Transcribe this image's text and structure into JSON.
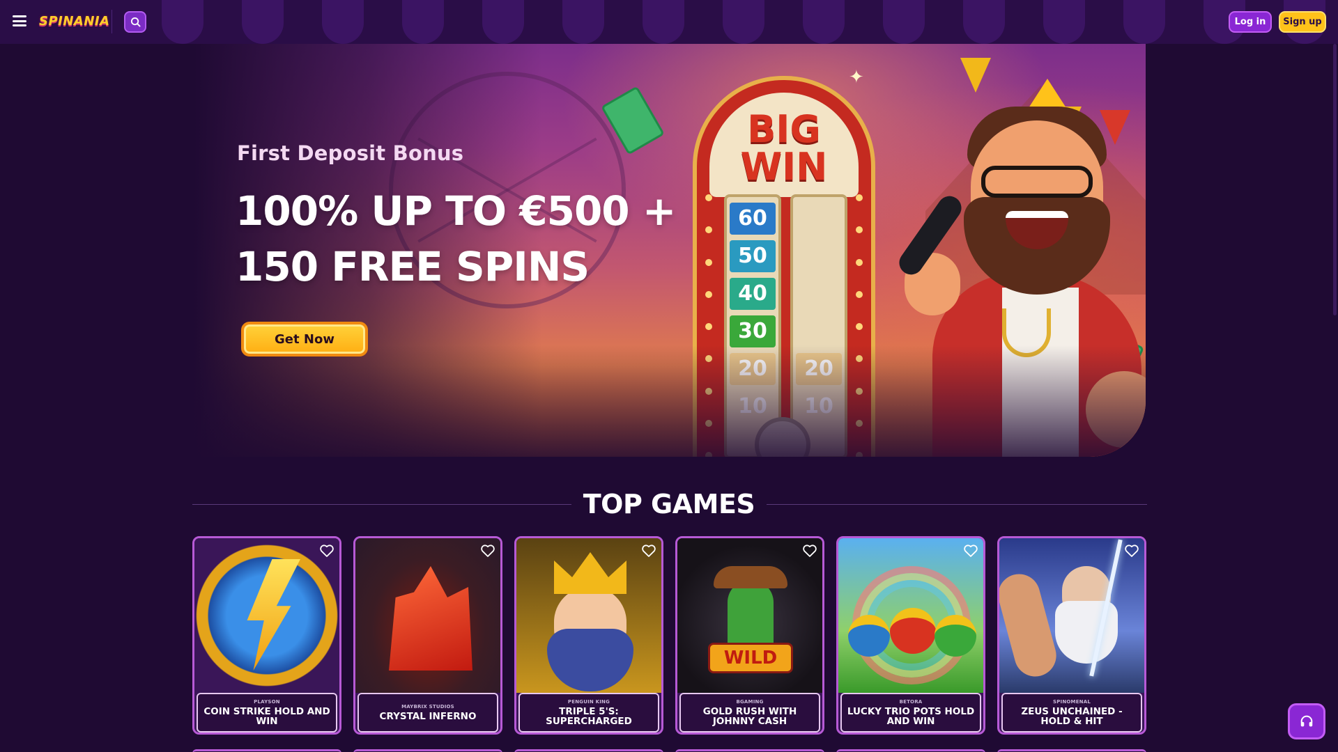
{
  "header": {
    "logo_text": "SPINANIA",
    "login_label": "Log in",
    "signup_label": "Sign up"
  },
  "banner": {
    "kicker": "First Deposit Bonus",
    "headline_line1": "100% UP TO €500 +",
    "headline_line2": "150 FREE SPINS",
    "cta_label": "Get Now",
    "sign_title_line1": "BIG",
    "sign_title_line2": "WIN",
    "meter_left": [
      "60",
      "50",
      "40",
      "30",
      "20",
      "10"
    ],
    "meter_right": [
      "20",
      "10"
    ]
  },
  "section": {
    "title": "TOP GAMES"
  },
  "games": [
    {
      "provider": "PLAYSON",
      "name": "COIN STRIKE HOLD AND WIN"
    },
    {
      "provider": "MAYBRIX STUDIOS",
      "name": "CRYSTAL INFERNO"
    },
    {
      "provider": "PENGUIN KING",
      "name": "TRIPLE 5'S: SUPERCHARGED"
    },
    {
      "provider": "BGAMING",
      "name": "GOLD RUSH WITH JOHNNY CASH",
      "art_text": "WILD"
    },
    {
      "provider": "BETORA",
      "name": "LUCKY TRIO POTS HOLD AND WIN"
    },
    {
      "provider": "SPINOMENAL",
      "name": "ZEUS UNCHAINED - HOLD & HIT"
    }
  ],
  "icons": {
    "menu": "hamburger-icon",
    "search": "search-icon",
    "favorite": "heart-icon",
    "support": "headset-icon"
  },
  "colors": {
    "background": "#1f0a33",
    "header": "#2a0d47",
    "primary_purple": "#8a27d4",
    "accent_yellow": "#ffc21a",
    "card_border": "#b75ad6"
  }
}
